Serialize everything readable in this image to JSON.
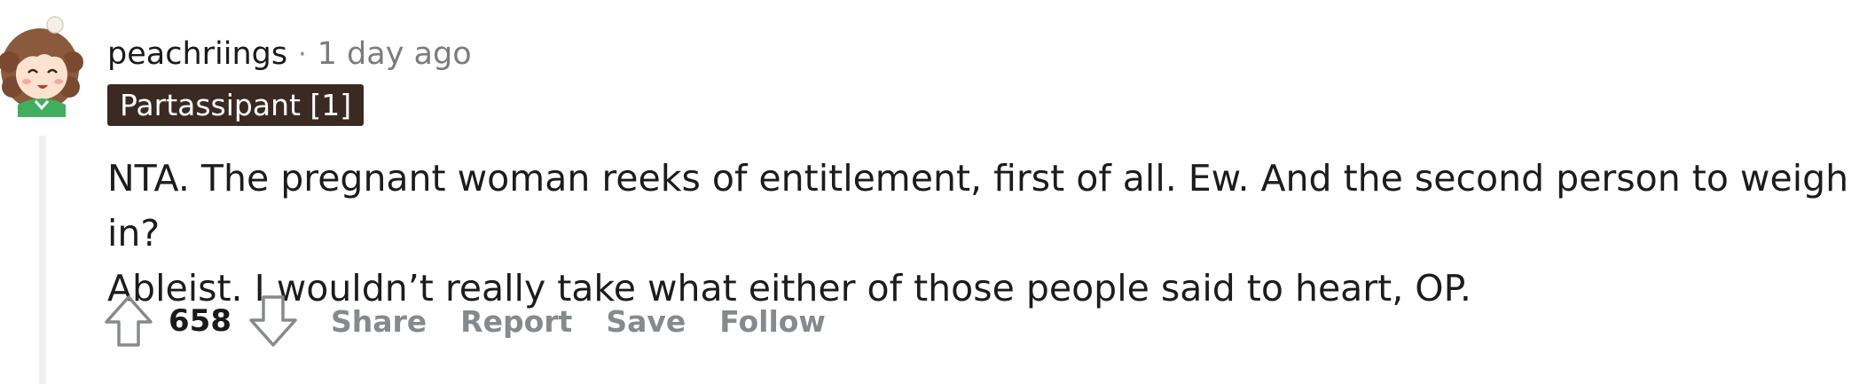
{
  "comment": {
    "author": "peachriings",
    "separator": "·",
    "timestamp": "1 day ago",
    "flair": "Partassipant [1]",
    "body_lines": [
      "NTA. The pregnant woman reeks of entitlement, first of all. Ew. And the second person to weigh in?",
      "Ableist. I wouldn’t really take what either of those people said to heart, OP."
    ]
  },
  "votes": {
    "score": "658",
    "upvote_icon": "arrow-up-icon",
    "downvote_icon": "arrow-down-icon"
  },
  "actions": {
    "share": "Share",
    "report": "Report",
    "save": "Save",
    "follow": "Follow"
  },
  "colors": {
    "flair_bg": "#3a2a22",
    "flair_text": "#ffffff",
    "muted": "#878a8c",
    "thread_line": "#edeff1"
  }
}
